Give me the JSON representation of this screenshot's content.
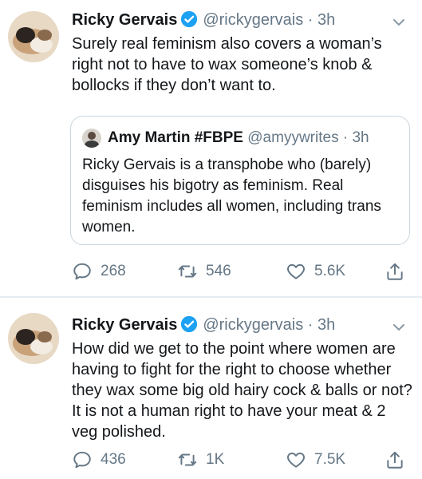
{
  "colors": {
    "meta": "#657786",
    "verified": "#1da1f2",
    "border": "#ccd6dd",
    "divider": "#e6ecf0"
  },
  "tweets": [
    {
      "name": "Ricky Gervais",
      "handle": "@rickygervais",
      "separator": "·",
      "time": "3h",
      "text": "Surely real feminism also covers a woman’s right not to have to wax someone’s knob & bollocks if they don’t want to.",
      "quote": {
        "name": "Amy Martin #FBPE",
        "handle": "@amyywrites",
        "separator": "·",
        "time": "3h",
        "text": "Ricky Gervais is a transphobe who (barely) disguises his bigotry as feminism. Real feminism includes all women, including trans women."
      },
      "replies": "268",
      "retweets": "546",
      "likes": "5.6K"
    },
    {
      "name": "Ricky Gervais",
      "handle": "@rickygervais",
      "separator": "·",
      "time": "3h",
      "text": "How did we get to the point where women are having to fight for the right to choose whether they wax some big old hairy cock & balls or not? It is not a human right to have your meat & 2 veg polished.",
      "replies": "436",
      "retweets": "1K",
      "likes": "7.5K"
    }
  ],
  "icons": {
    "reply": "reply-icon",
    "retweet": "retweet-icon",
    "like": "heart-icon",
    "share": "share-icon",
    "verified": "verified-badge-icon",
    "caret": "chevron-down-icon"
  }
}
